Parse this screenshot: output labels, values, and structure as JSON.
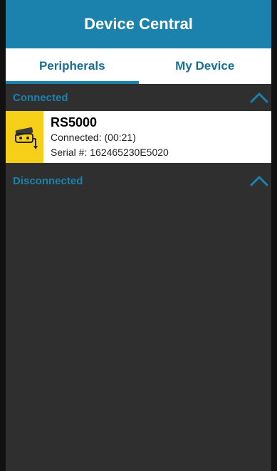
{
  "app": {
    "title": "Device Central"
  },
  "tabs": [
    {
      "label": "Peripherals",
      "active": true
    },
    {
      "label": "My Device",
      "active": false
    }
  ],
  "sections": {
    "connected": {
      "label": "Connected"
    },
    "disconnected": {
      "label": "Disconnected"
    }
  },
  "device": {
    "name": "RS5000",
    "status": "Connected: (00:21)",
    "serial": "Serial #: 162465230E5020",
    "icon": "ring-scanner-icon"
  },
  "colors": {
    "accent": "#1a82ad",
    "device_icon_bg": "#f6cf19",
    "background": "#2f2f2f"
  }
}
